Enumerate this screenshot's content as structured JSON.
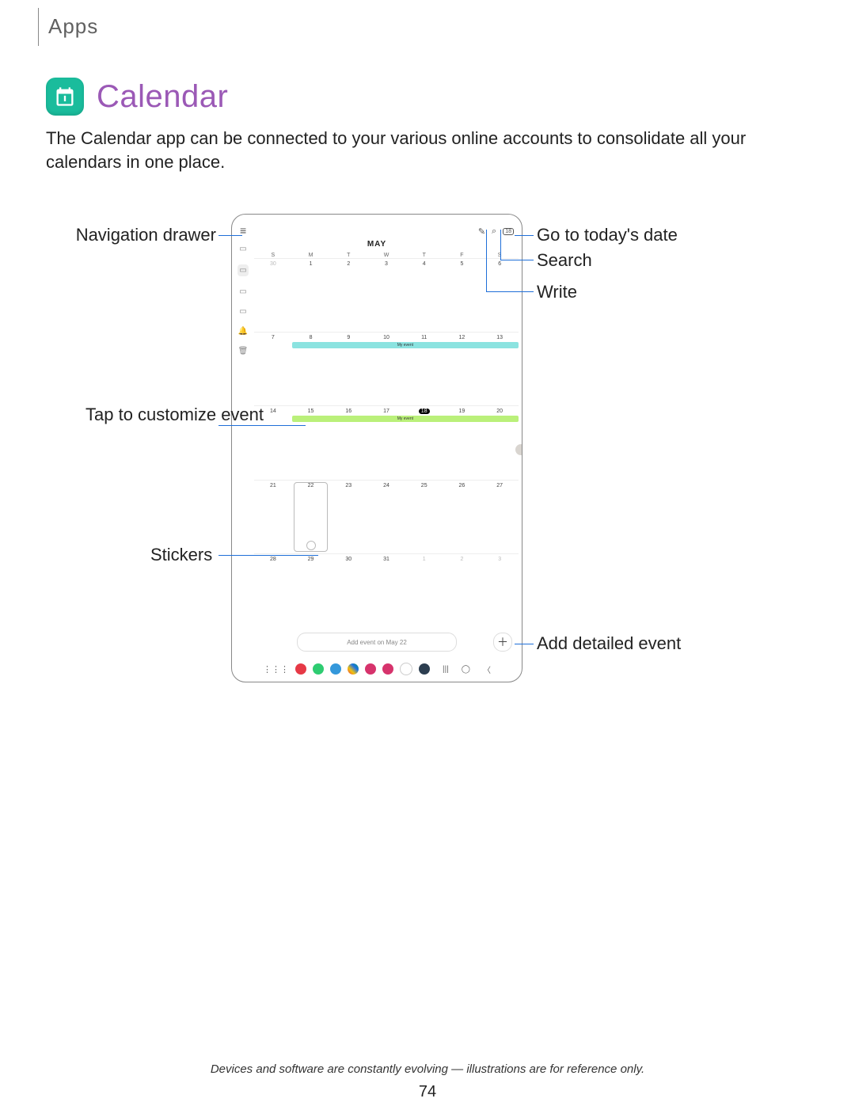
{
  "header": {
    "section": "Apps"
  },
  "title": {
    "text": "Calendar"
  },
  "intro": "The Calendar app can be connected to your various online accounts to consolidate all your calendars in one place.",
  "device": {
    "month": "MAY",
    "dow": [
      "S",
      "M",
      "T",
      "W",
      "T",
      "F",
      "S"
    ],
    "weeks": [
      {
        "days": [
          "30",
          "1",
          "2",
          "3",
          "4",
          "5",
          "6"
        ],
        "muted": [
          0
        ]
      },
      {
        "days": [
          "7",
          "8",
          "9",
          "10",
          "11",
          "12",
          "13"
        ],
        "event": {
          "label": "My event",
          "class": "ev-teal",
          "fromCol": 2,
          "toCol": 7
        }
      },
      {
        "days": [
          "14",
          "15",
          "16",
          "17",
          "18",
          "19",
          "20"
        ],
        "today": 4,
        "event": {
          "label": "My event",
          "class": "ev-green",
          "fromCol": 2,
          "toCol": 7
        }
      },
      {
        "days": [
          "21",
          "22",
          "23",
          "24",
          "25",
          "26",
          "27"
        ],
        "selected": 1,
        "sticker": 1
      },
      {
        "days": [
          "28",
          "29",
          "30",
          "31",
          "1",
          "2",
          "3"
        ],
        "muted": [
          4,
          5,
          6
        ]
      }
    ],
    "addBar": "Add event on May 22"
  },
  "callouts": {
    "nav": "Navigation drawer",
    "today": "Go to today's date",
    "search": "Search",
    "write": "Write",
    "customize": "Tap to customize event",
    "stickers": "Stickers",
    "addDetail": "Add detailed event"
  },
  "footer": {
    "note": "Devices and software are constantly evolving — illustrations are for reference only.",
    "page": "74"
  }
}
